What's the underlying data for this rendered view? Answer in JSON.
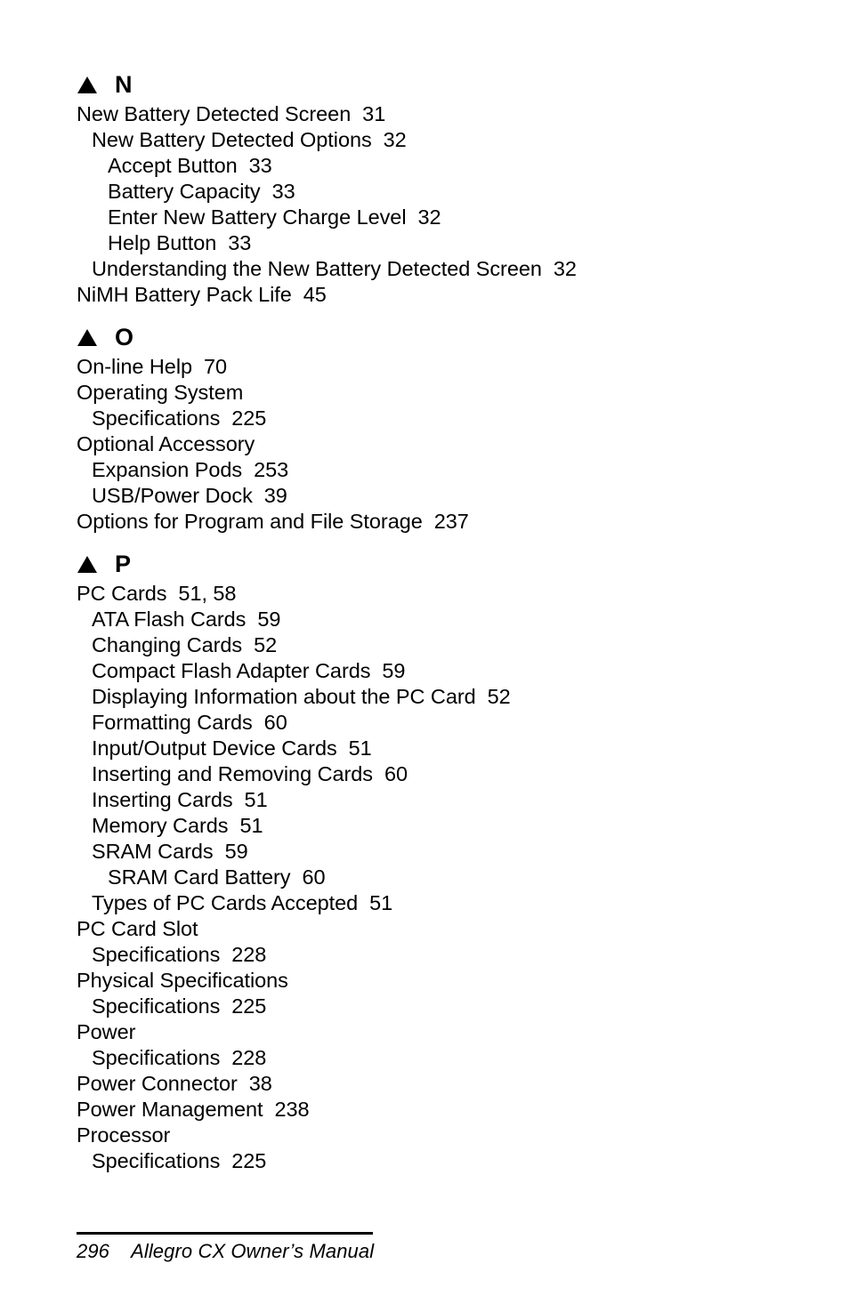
{
  "document": {
    "type": "index",
    "page_number": "296",
    "footer_title": "Allegro CX Owner’s Manual"
  },
  "sections": [
    {
      "letter": "N",
      "bullet_icon": "triangle-up-icon",
      "entries": [
        {
          "level": 0,
          "text": "New Battery Detected Screen  31"
        },
        {
          "level": 1,
          "text": "New Battery Detected Options  32"
        },
        {
          "level": 2,
          "text": "Accept Button  33"
        },
        {
          "level": 2,
          "text": "Battery Capacity  33"
        },
        {
          "level": 2,
          "text": "Enter New Battery Charge Level  32"
        },
        {
          "level": 2,
          "text": "Help Button  33"
        },
        {
          "level": 1,
          "text": "Understanding the New Battery Detected Screen  32"
        },
        {
          "level": 0,
          "text": "NiMH Battery Pack Life  45"
        }
      ]
    },
    {
      "letter": "O",
      "bullet_icon": "triangle-up-icon",
      "entries": [
        {
          "level": 0,
          "text": "On-line Help  70"
        },
        {
          "level": 0,
          "text": "Operating System"
        },
        {
          "level": 1,
          "text": "Specifications  225"
        },
        {
          "level": 0,
          "text": "Optional Accessory"
        },
        {
          "level": 1,
          "text": "Expansion Pods  253"
        },
        {
          "level": 1,
          "text": "USB/Power Dock  39"
        },
        {
          "level": 0,
          "text": "Options for Program and File Storage  237"
        }
      ]
    },
    {
      "letter": "P",
      "bullet_icon": "triangle-up-icon",
      "entries": [
        {
          "level": 0,
          "text": "PC Cards  51, 58"
        },
        {
          "level": 1,
          "text": "ATA Flash Cards  59"
        },
        {
          "level": 1,
          "text": "Changing Cards  52"
        },
        {
          "level": 1,
          "text": "Compact Flash Adapter Cards  59"
        },
        {
          "level": 1,
          "text": "Displaying Information about the PC Card  52"
        },
        {
          "level": 1,
          "text": "Formatting Cards  60"
        },
        {
          "level": 1,
          "text": "Input/Output Device Cards  51"
        },
        {
          "level": 1,
          "text": "Inserting and Removing Cards  60"
        },
        {
          "level": 1,
          "text": "Inserting Cards  51"
        },
        {
          "level": 1,
          "text": "Memory Cards  51"
        },
        {
          "level": 1,
          "text": "SRAM Cards  59"
        },
        {
          "level": 2,
          "text": "SRAM Card Battery  60"
        },
        {
          "level": 1,
          "text": "Types of PC Cards Accepted  51"
        },
        {
          "level": 0,
          "text": "PC Card Slot"
        },
        {
          "level": 1,
          "text": "Specifications  228"
        },
        {
          "level": 0,
          "text": "Physical Specifications"
        },
        {
          "level": 1,
          "text": "Specifications  225"
        },
        {
          "level": 0,
          "text": "Power"
        },
        {
          "level": 1,
          "text": "Specifications  228"
        },
        {
          "level": 0,
          "text": "Power Connector  38"
        },
        {
          "level": 0,
          "text": "Power Management  238"
        },
        {
          "level": 0,
          "text": "Processor"
        },
        {
          "level": 1,
          "text": "Specifications  225"
        }
      ]
    }
  ]
}
